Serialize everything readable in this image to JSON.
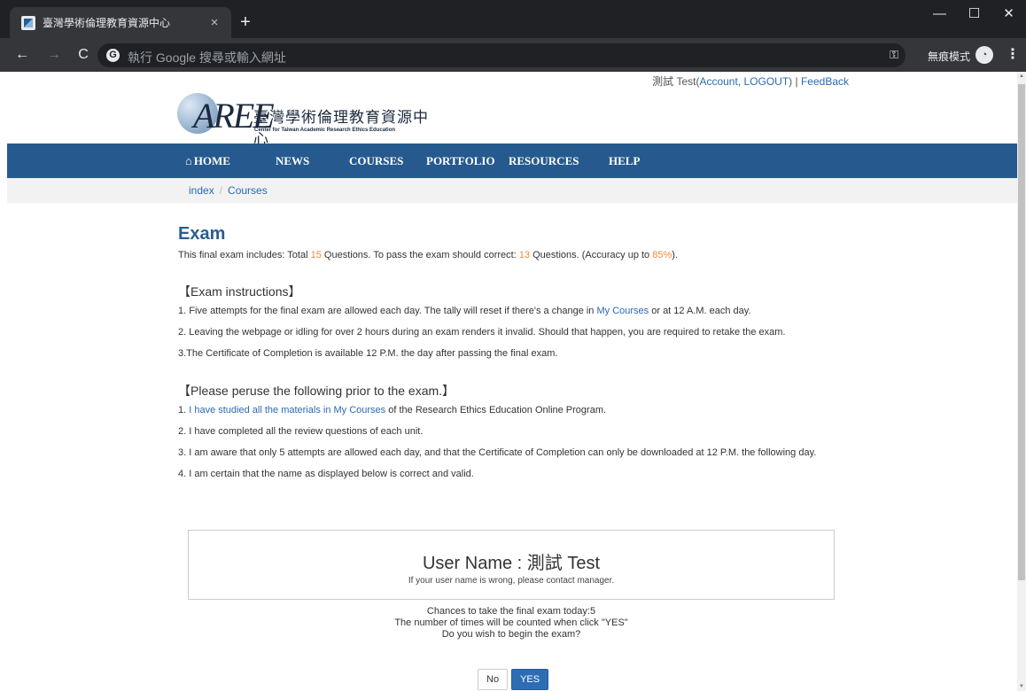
{
  "browser": {
    "tab_title": "臺灣學術倫理教育資源中心",
    "tab_close": "×",
    "new_tab": "+",
    "address_placeholder": "執行 Google 搜尋或輸入網址",
    "incognito_label": "無痕模式",
    "window_buttons": {
      "minimize": "—",
      "maximize": "☐",
      "close": "✕"
    }
  },
  "userbar": {
    "user": "測試 Test",
    "account": "Account",
    "logout": "LOGOUT",
    "separator": "|",
    "feedback": "FeedBack"
  },
  "logo": {
    "mark": "AREE",
    "zh": "臺灣學術倫理教育資源中心",
    "en": "Center for Taiwan Academic Research Ethics Education"
  },
  "nav": {
    "items": [
      "HOME",
      "NEWS",
      "COURSES",
      "PORTFOLIO",
      "RESOURCES",
      "HELP"
    ]
  },
  "breadcrumb": [
    "index",
    "Courses"
  ],
  "exam": {
    "title": "Exam",
    "summary_prefix": "This final exam includes: Total ",
    "total": "15",
    "summary_mid": " Questions. To pass the exam should correct: ",
    "pass": "13",
    "summary_mid2": " Questions. (Accuracy up to ",
    "accuracy": "85%",
    "summary_suffix": ")."
  },
  "instructions": {
    "title": "【Exam instructions】",
    "items": [
      "1. Five attempts for the final exam are allowed each day. The tally will reset if there's a change in ",
      "2. Leaving the webpage or idling for over 2 hours during an exam renders it invalid. Should that happen, you are required to retake the exam.",
      "3.The Certificate of Completion is available 12 P.M. the day after passing the final exam."
    ],
    "item1_link": "My Courses",
    "item1_end": " or at 12 A.M. each day."
  },
  "peruse": {
    "title": "【Please peruse the following prior to the exam.】",
    "item1_a": "1. ",
    "item1_b": "I have studied all the materials in ",
    "item1_c": "My Courses",
    "item1_d": " of the Research Ethics Education Online Program.",
    "items": [
      "2. I have completed all the review questions of each unit.",
      "3. I am aware that only 5 attempts are allowed each day, and that the Certificate of Completion can only be downloaded at 12 P.M. the following day.",
      "4. I am certain that the name as displayed below is correct and valid."
    ]
  },
  "user_box": {
    "name": "User Name : 測試 Test",
    "note": "If your user name is wrong, please contact manager."
  },
  "confirm": {
    "line1": "Chances to take the final exam today:5",
    "line2": "The number of times will be counted when click \"YES\"",
    "line3": "Do you wish to begin the exam?"
  },
  "buttons": {
    "no": "No",
    "yes": "YES"
  },
  "colors": {
    "nav_bg": "#265a8e",
    "accent": "#2a6ab3",
    "highlight": "#f0883e",
    "yes_button": "#2d6db4"
  }
}
